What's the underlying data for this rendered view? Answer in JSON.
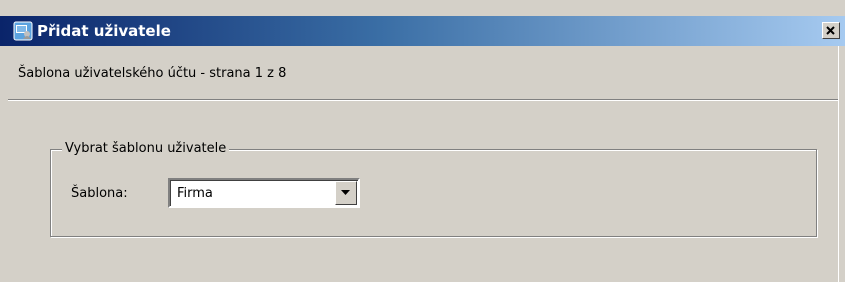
{
  "window": {
    "title": "Přidat uživatele",
    "title_icon": "users-add-icon",
    "close_icon": "close-icon"
  },
  "wizard": {
    "subtitle": "Šablona uživatelského účtu - strana 1 z 8"
  },
  "group": {
    "legend": "Vybrat šablonu uživatele",
    "template_label": "Šablona:",
    "template_value": "Firma",
    "dropdown_icon": "chevron-down-icon"
  },
  "colors": {
    "titlebar_start": "#0a246a",
    "titlebar_end": "#a6caf0",
    "face": "#d4d0c8"
  }
}
